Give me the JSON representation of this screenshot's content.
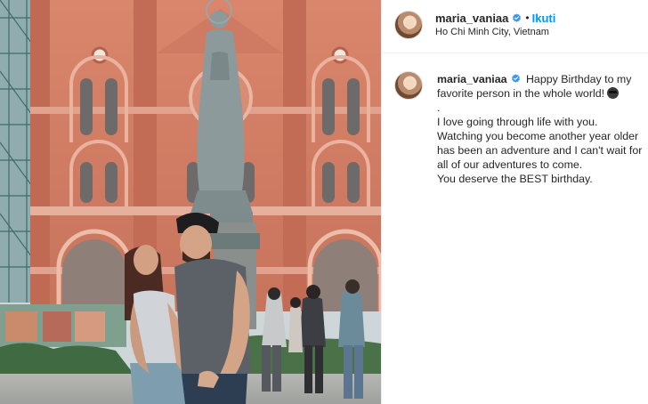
{
  "post": {
    "username": "maria_vaniaa",
    "follow_label": "Ikuti",
    "separator": "•",
    "location": "Ho Chi Minh City, Vietnam",
    "verified_icon": "verified-badge-icon"
  },
  "caption": {
    "username": "maria_vaniaa",
    "intro": "Happy Birthday to my favorite person in the whole world!",
    "emoji_icon": "ninja-emoji-icon",
    "lines": [
      ".",
      "I love going through life with you. Watching you become another year older has been an adventure and I can't wait for all of our adventures to come.",
      "You deserve the BEST birthday."
    ]
  },
  "colors": {
    "accent_blue": "#0095f6",
    "verified_blue": "#3897f0",
    "text": "#262626"
  }
}
